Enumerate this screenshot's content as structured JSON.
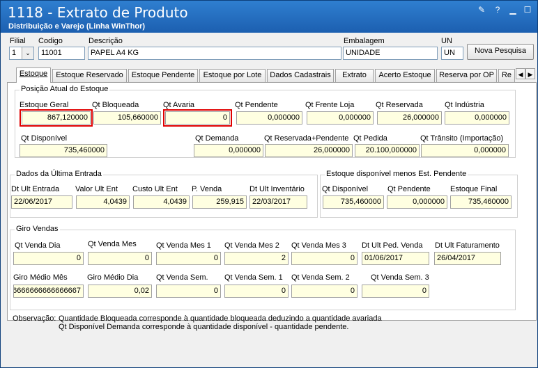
{
  "window": {
    "title": "1118 - Extrato de Produto",
    "subtitle": "Distribuição e Varejo (Linha WinThor)"
  },
  "header": {
    "filial_label": "Filial",
    "filial_value": "1",
    "codigo_label": "Codigo",
    "codigo_value": "11001",
    "descricao_label": "Descrição",
    "descricao_value": "PAPEL A4 KG",
    "embalagem_label": "Embalagem",
    "embalagem_value": "UNIDADE",
    "un_label": "UN",
    "un_value": "UN",
    "nova_pesquisa_label": "Nova Pesquisa"
  },
  "tabs": [
    {
      "label": "Estoque"
    },
    {
      "label": "Estoque Reservado"
    },
    {
      "label": "Estoque Pendente"
    },
    {
      "label": "Estoque por Lote"
    },
    {
      "label": "Dados Cadastrais"
    },
    {
      "label": "Extrato"
    },
    {
      "label": "Acerto Estoque"
    },
    {
      "label": "Reserva por OP"
    },
    {
      "label": "Re"
    }
  ],
  "posicao": {
    "title": "Posição Atual do Estoque",
    "estoque_geral_label": "Estoque Geral",
    "estoque_geral": "867,120000",
    "qt_bloqueada_label": "Qt Bloqueada",
    "qt_bloqueada": "105,660000",
    "qt_avaria_label": "Qt Avaria",
    "qt_avaria": "0",
    "qt_pendente_label": "Qt Pendente",
    "qt_pendente": "0,000000",
    "qt_frente_loja_label": "Qt Frente Loja",
    "qt_frente_loja": "0,000000",
    "qt_reservada_label": "Qt Reservada",
    "qt_reservada": "26,000000",
    "qt_industria_label": "Qt Indústria",
    "qt_industria": "0,000000",
    "qt_disponivel_label": "Qt Disponível",
    "qt_disponivel": "735,460000",
    "qt_demanda_label": "Qt Demanda",
    "qt_demanda": "0,000000",
    "qt_reservada_pendente_label": "Qt Reservada+Pendente",
    "qt_reservada_pendente": "26,000000",
    "qt_pedida_label": "Qt Pedida",
    "qt_pedida": "20.100,000000",
    "qt_transito_label": "Qt Trânsito (Importação)",
    "qt_transito": "0,000000"
  },
  "ultima_entrada": {
    "title": "Dados da Última Entrada",
    "dt_ult_entrada_label": "Dt Ult Entrada",
    "dt_ult_entrada": "22/06/2017",
    "valor_ult_ent_label": "Valor Ult Ent",
    "valor_ult_ent": "4,0439",
    "custo_ult_ent_label": "Custo Ult Ent",
    "custo_ult_ent": "4,0439",
    "p_venda_label": "P. Venda",
    "p_venda": "259,915",
    "dt_ult_inventario_label": "Dt Ult Inventário",
    "dt_ult_inventario": "22/03/2017"
  },
  "disponivel_menos_pendente": {
    "title": "Estoque disponível menos Est. Pendente",
    "qt_disponivel_label": "Qt Disponível",
    "qt_disponivel": "735,460000",
    "qt_pendente_label": "Qt Pendente",
    "qt_pendente": "0,000000",
    "estoque_final_label": "Estoque Final",
    "estoque_final": "735,460000"
  },
  "giro": {
    "title": "Giro Vendas",
    "qt_venda_dia_label": "Qt Venda Dia",
    "qt_venda_dia": "0",
    "qt_venda_mes_label": "Qt Venda Mes",
    "qt_venda_mes": "0",
    "qt_venda_mes1_label": "Qt Venda Mes 1",
    "qt_venda_mes1": "0",
    "qt_venda_mes2_label": "Qt Venda Mes 2",
    "qt_venda_mes2": "2",
    "qt_venda_mes3_label": "Qt Venda Mes 3",
    "qt_venda_mes3": "0",
    "dt_ult_ped_venda_label": "Dt Ult Ped. Venda",
    "dt_ult_ped_venda": "01/06/2017",
    "dt_ult_faturamento_label": "Dt Ult Faturamento",
    "dt_ult_faturamento": "26/04/2017",
    "giro_medio_mes_label": "Giro Médio Mês",
    "giro_medio_mes": "56666666666666667",
    "giro_medio_dia_label": "Giro Médio Dia",
    "giro_medio_dia": "0,02",
    "qt_venda_sem_label": "Qt Venda Sem.",
    "qt_venda_sem": "0",
    "qt_venda_sem1_label": "Qt Venda Sem. 1",
    "qt_venda_sem1": "0",
    "qt_venda_sem2_label": "Qt Venda Sem. 2",
    "qt_venda_sem2": "0",
    "qt_venda_sem3_label": "Qt Venda Sem. 3",
    "qt_venda_sem3": "0"
  },
  "observacao": {
    "label": "Observação:",
    "line1": "Quantidade Bloqueada corresponde à quantidade bloqueada deduzindo a quantidade avariada",
    "line2": "Qt Disponível Demanda corresponde à quantidade disponível - quantidade pendente."
  },
  "colors": {
    "title_bar": "#1c5fb0",
    "highlight": "#e00000",
    "readonly_field": "#ffffe1"
  }
}
